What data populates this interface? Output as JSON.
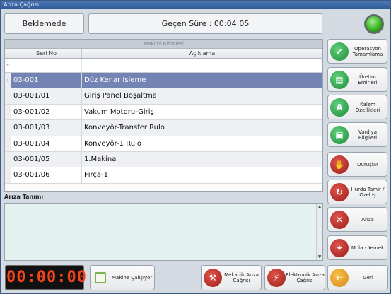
{
  "window": {
    "title": "Arıza Çağrısı"
  },
  "status": {
    "text": "Beklemede"
  },
  "elapsed": {
    "text": "Geçen Süre : 00:04:05"
  },
  "indicator": {
    "state": "green",
    "color": "#2ea81c"
  },
  "grid": {
    "caption": "Makina Birimleri",
    "columns": [
      "Seri No",
      "Açıklama"
    ],
    "rows": [
      {
        "seri": "03-001",
        "aciklama": "Düz Kenar İşleme",
        "selected": true
      },
      {
        "seri": "03-001/01",
        "aciklama": "Giriş Panel Boşaltma"
      },
      {
        "seri": "03-001/02",
        "aciklama": "Vakum Motoru-Giriş"
      },
      {
        "seri": "03-001/03",
        "aciklama": "Konveyör-Transfer Rulo"
      },
      {
        "seri": "03-001/04",
        "aciklama": "Konveyör-1 Rulo"
      },
      {
        "seri": "03-001/05",
        "aciklama": "1.Makina"
      },
      {
        "seri": "03-001/06",
        "aciklama": "Fırça-1"
      }
    ]
  },
  "ariza": {
    "label": "Arıza Tanımı",
    "value": ""
  },
  "side_buttons": [
    {
      "label": "Operasyon Tamamlama",
      "icon": "operation-complete-icon",
      "color": "green"
    },
    {
      "label": "Üretim Emirleri",
      "icon": "production-orders-icon",
      "color": "green"
    },
    {
      "label": "Kalem Özellikleri",
      "icon": "item-properties-icon",
      "color": "green"
    },
    {
      "label": "Vardiya Bilgileri",
      "icon": "shift-info-icon",
      "color": "green"
    },
    {
      "label": "Duruşlar",
      "icon": "stop-hand-icon",
      "color": "red"
    },
    {
      "label": "Hurda Tamir / Özel İş",
      "icon": "scrap-repair-icon",
      "color": "red"
    },
    {
      "label": "Arıza",
      "icon": "fault-icon",
      "color": "red"
    },
    {
      "label": "Mola - Yemek",
      "icon": "break-meal-icon",
      "color": "red"
    }
  ],
  "bottom": {
    "counter": "00:00:00",
    "machine_running_label": "Makine Çalışıyor",
    "mechanical_label": "Mekanik Arıza Çağrısı",
    "electronic_label": "Elektronik Arıza Çağrısı",
    "back_label": "Geri"
  }
}
